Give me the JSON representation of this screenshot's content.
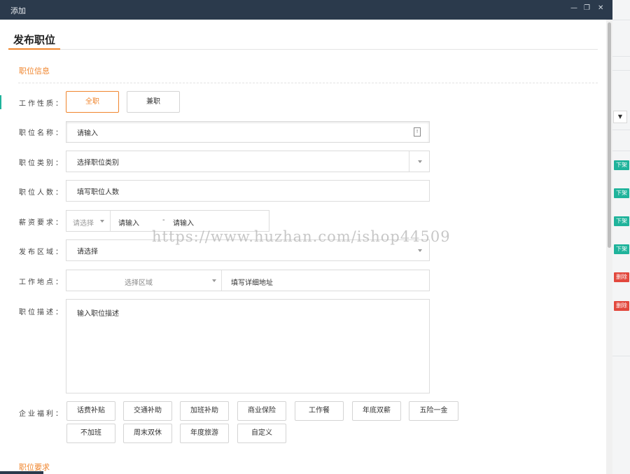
{
  "window": {
    "title": "添加",
    "minimize_icon": "minimize-icon",
    "restore_icon": "restore-icon",
    "close_icon": "close-icon"
  },
  "page_title": "发布职位",
  "section_job_info": "职位信息",
  "section_job_requirements": "职位要求",
  "form": {
    "job_type": {
      "label": "工作性质：",
      "options": [
        "全职",
        "兼职"
      ],
      "selected": "全职"
    },
    "job_name": {
      "label": "职位名称：",
      "placeholder": "请输入"
    },
    "job_category": {
      "label": "职位类别：",
      "placeholder": "选择职位类别"
    },
    "headcount": {
      "label": "职位人数：",
      "placeholder": "填写职位人数"
    },
    "salary": {
      "label": "薪资要求：",
      "unit_placeholder": "请选择",
      "min_placeholder": "请输入",
      "range_sep": "-",
      "max_placeholder": "请输入"
    },
    "publish_area": {
      "label": "发布区域：",
      "placeholder": "请选择"
    },
    "work_location": {
      "label": "工作地点：",
      "region_placeholder": "选择区域",
      "address_placeholder": "填写详细地址"
    },
    "description": {
      "label": "职位描述：",
      "placeholder": "输入职位描述"
    },
    "benefits": {
      "label": "企业福利：",
      "items": [
        "话费补贴",
        "交通补助",
        "加班补助",
        "商业保险",
        "工作餐",
        "年底双薪",
        "五险一金",
        "不加班",
        "周末双休",
        "年度旅游",
        "自定义"
      ]
    }
  },
  "background": {
    "badges": [
      "下架",
      "下架",
      "下架",
      "下架",
      "删除",
      "删除"
    ]
  },
  "watermark": "https://www.huzhan.com/ishop44509",
  "colors": {
    "accent": "#f0852d",
    "titlebar": "#2b3a4c",
    "badge_green": "#1fb39b",
    "badge_red": "#e2483d"
  }
}
